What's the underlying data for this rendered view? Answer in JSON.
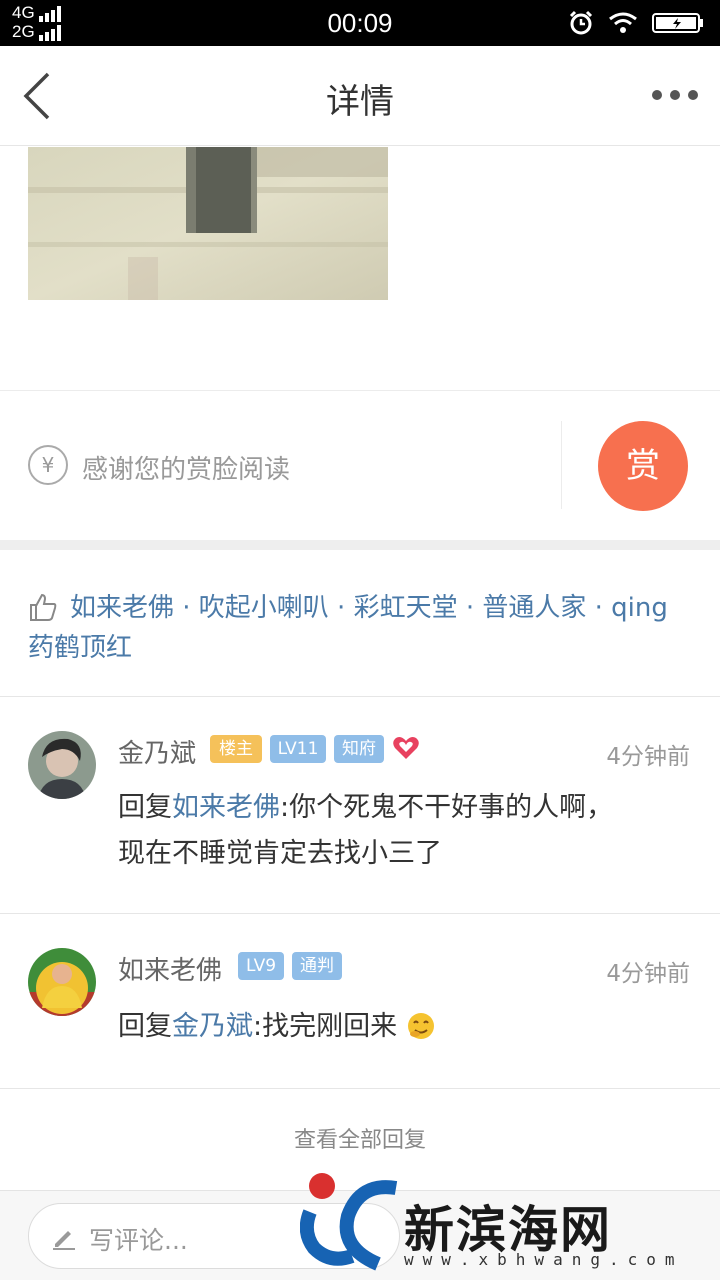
{
  "status_bar": {
    "network_top": "4G",
    "network_bottom": "2G",
    "time": "00:09"
  },
  "header": {
    "title": "详情"
  },
  "reward": {
    "currency_symbol": "¥",
    "text": "感谢您的赏脸阅读",
    "button_label": "赏"
  },
  "likes": {
    "line1": "如来老佛 · 吹起小喇叭 · 彩虹天堂 · 普通人家 · qing",
    "line2": "药鹤顶红"
  },
  "comments": [
    {
      "name": "金乃斌",
      "badges": [
        "楼主",
        "LV11",
        "知府"
      ],
      "time": "4分钟前",
      "reply_prefix": "回复",
      "mention": "如来老佛",
      "text_line1": ":你个死鬼不干好事的人啊，",
      "text_line2": "现在不睡觉肯定去找小三了"
    },
    {
      "name": "如来老佛",
      "badges": [
        "LV9",
        "通判"
      ],
      "time": "4分钟前",
      "reply_prefix": "回复",
      "mention": "金乃斌",
      "text": ":找完刚回来"
    }
  ],
  "view_all": "查看全部回复",
  "bottom_bar": {
    "comment_placeholder": "写评论..."
  },
  "watermark": {
    "name": "新滨海网",
    "url": "www.xbhwang.com"
  },
  "colors": {
    "accent_link": "#4b7aa8",
    "reward_button": "#f7704f",
    "host_badge": "#f5c15a",
    "level_badge": "#8fbde8"
  }
}
